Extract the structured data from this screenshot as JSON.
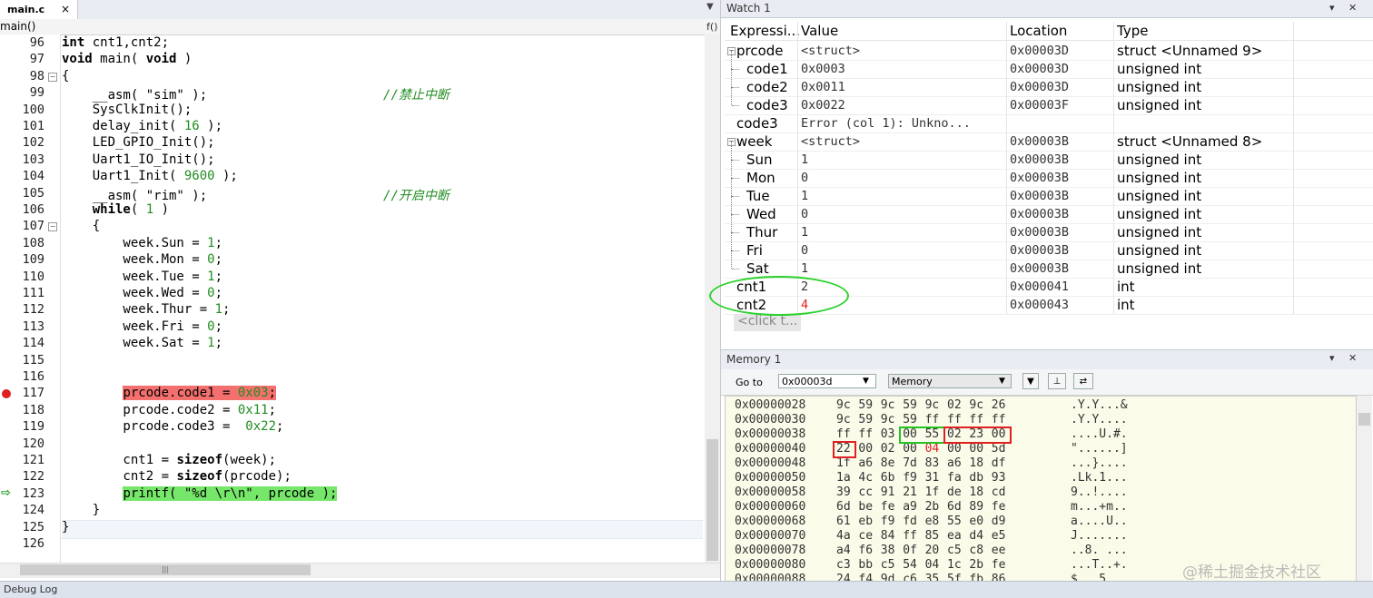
{
  "editor": {
    "tab_label": "main.c",
    "tab_close": "×",
    "tab_arrow": "▼",
    "function": "main()",
    "func_icon": "f()",
    "lines": [
      {
        "n": "96",
        "text": "int cnt1,cnt2;"
      },
      {
        "n": "97",
        "text": "void main( void )"
      },
      {
        "n": "98",
        "text": "{"
      },
      {
        "n": "99",
        "text": "    __asm( \"sim\" );                       //禁止中断"
      },
      {
        "n": "100",
        "text": "    SysClkInit();"
      },
      {
        "n": "101",
        "text": "    delay_init( 16 );"
      },
      {
        "n": "102",
        "text": "    LED_GPIO_Init();"
      },
      {
        "n": "103",
        "text": "    Uart1_IO_Init();"
      },
      {
        "n": "104",
        "text": "    Uart1_Init( 9600 );"
      },
      {
        "n": "105",
        "text": "    __asm( \"rim\" );                       //开启中断"
      },
      {
        "n": "106",
        "text": "    while( 1 )"
      },
      {
        "n": "107",
        "text": "    {"
      },
      {
        "n": "108",
        "text": "        week.Sun = 1;"
      },
      {
        "n": "109",
        "text": "        week.Mon = 0;"
      },
      {
        "n": "110",
        "text": "        week.Tue = 1;"
      },
      {
        "n": "111",
        "text": "        week.Wed = 0;"
      },
      {
        "n": "112",
        "text": "        week.Thur = 1;"
      },
      {
        "n": "113",
        "text": "        week.Fri = 0;"
      },
      {
        "n": "114",
        "text": "        week.Sat = 1;"
      },
      {
        "n": "115",
        "text": ""
      },
      {
        "n": "116",
        "text": ""
      },
      {
        "n": "117",
        "text": "        prcode.code1 = 0x03;"
      },
      {
        "n": "118",
        "text": "        prcode.code2 = 0x11;"
      },
      {
        "n": "119",
        "text": "        prcode.code3 =  0x22;"
      },
      {
        "n": "120",
        "text": ""
      },
      {
        "n": "121",
        "text": "        cnt1 = sizeof(week);"
      },
      {
        "n": "122",
        "text": "        cnt2 = sizeof(prcode);"
      },
      {
        "n": "123",
        "text": "        printf( \"%d \\r\\n\", prcode );"
      },
      {
        "n": "124",
        "text": "    }"
      },
      {
        "n": "125",
        "text": "}"
      },
      {
        "n": "126",
        "text": ""
      }
    ]
  },
  "watch": {
    "title": "Watch 1",
    "buttons": "▾ ✕",
    "headers": {
      "expr": "Expressi...",
      "value": "Value",
      "location": "Location",
      "type": "Type"
    },
    "rows": [
      {
        "name": "prcode",
        "value": "<struct>",
        "location": "0x00003D",
        "type": "struct <Unnamed 9>",
        "level": 0,
        "expand": true
      },
      {
        "name": "code1",
        "value": "0x0003",
        "location": "0x00003D",
        "type": "unsigned int",
        "level": 1
      },
      {
        "name": "code2",
        "value": "0x0011",
        "location": "0x00003D",
        "type": "unsigned int",
        "level": 1
      },
      {
        "name": "code3",
        "value": "0x0022",
        "location": "0x00003F",
        "type": "unsigned int",
        "level": 1
      },
      {
        "name": "code3",
        "value": "Error (col 1): Unkno...",
        "location": "",
        "type": "",
        "level": 0
      },
      {
        "name": "week",
        "value": "<struct>",
        "location": "0x00003B",
        "type": "struct <Unnamed 8>",
        "level": 0,
        "expand": true
      },
      {
        "name": "Sun",
        "value": "1",
        "location": "0x00003B",
        "type": "unsigned int",
        "level": 1
      },
      {
        "name": "Mon",
        "value": "0",
        "location": "0x00003B",
        "type": "unsigned int",
        "level": 1
      },
      {
        "name": "Tue",
        "value": "1",
        "location": "0x00003B",
        "type": "unsigned int",
        "level": 1
      },
      {
        "name": "Wed",
        "value": "0",
        "location": "0x00003B",
        "type": "unsigned int",
        "level": 1
      },
      {
        "name": "Thur",
        "value": "1",
        "location": "0x00003B",
        "type": "unsigned int",
        "level": 1
      },
      {
        "name": "Fri",
        "value": "0",
        "location": "0x00003B",
        "type": "unsigned int",
        "level": 1
      },
      {
        "name": "Sat",
        "value": "1",
        "location": "0x00003B",
        "type": "unsigned int",
        "level": 1
      },
      {
        "name": "cnt1",
        "value": "2",
        "location": "0x000041",
        "type": "int",
        "level": 0
      },
      {
        "name": "cnt2",
        "value": "4",
        "location": "0x000043",
        "type": "int",
        "level": 0,
        "changed": true
      }
    ],
    "click_to_add": "<click t..."
  },
  "memory": {
    "title": "Memory 1",
    "buttons": "▾ ✕",
    "goto_label": "Go to",
    "goto_value": "0x00003d",
    "zone": "Memory",
    "rows": [
      {
        "addr": "0x00000028",
        "bytes": [
          "9c",
          "59",
          "9c",
          "59",
          "9c",
          "02",
          "9c",
          "26"
        ],
        "ascii": ".Y.Y...&"
      },
      {
        "addr": "0x00000030",
        "bytes": [
          "9c",
          "59",
          "9c",
          "59",
          "ff",
          "ff",
          "ff",
          "ff"
        ],
        "ascii": ".Y.Y...."
      },
      {
        "addr": "0x00000038",
        "bytes": [
          "ff",
          "ff",
          "03",
          "00",
          "55",
          "02",
          "23",
          "00"
        ],
        "ascii": "....U.#."
      },
      {
        "addr": "0x00000040",
        "bytes": [
          "22",
          "00",
          "02",
          "00",
          "04",
          "00",
          "00",
          "5d"
        ],
        "ascii": "\"......]"
      },
      {
        "addr": "0x00000048",
        "bytes": [
          "1f",
          "a6",
          "8e",
          "7d",
          "83",
          "a6",
          "18",
          "df"
        ],
        "ascii": "...}...."
      },
      {
        "addr": "0x00000050",
        "bytes": [
          "1a",
          "4c",
          "6b",
          "f9",
          "31",
          "fa",
          "db",
          "93"
        ],
        "ascii": ".Lk.1..."
      },
      {
        "addr": "0x00000058",
        "bytes": [
          "39",
          "cc",
          "91",
          "21",
          "1f",
          "de",
          "18",
          "cd"
        ],
        "ascii": "9..!...."
      },
      {
        "addr": "0x00000060",
        "bytes": [
          "6d",
          "be",
          "fe",
          "a9",
          "2b",
          "6d",
          "89",
          "fe"
        ],
        "ascii": "m...+m.."
      },
      {
        "addr": "0x00000068",
        "bytes": [
          "61",
          "eb",
          "f9",
          "fd",
          "e8",
          "55",
          "e0",
          "d9"
        ],
        "ascii": "a....U.."
      },
      {
        "addr": "0x00000070",
        "bytes": [
          "4a",
          "ce",
          "84",
          "ff",
          "85",
          "ea",
          "d4",
          "e5"
        ],
        "ascii": "J......."
      },
      {
        "addr": "0x00000078",
        "bytes": [
          "a4",
          "f6",
          "38",
          "0f",
          "20",
          "c5",
          "c8",
          "ee"
        ],
        "ascii": "..8. ..."
      },
      {
        "addr": "0x00000080",
        "bytes": [
          "c3",
          "bb",
          "c5",
          "54",
          "04",
          "1c",
          "2b",
          "fe"
        ],
        "ascii": "...T..+."
      },
      {
        "addr": "0x00000088",
        "bytes": [
          "24",
          "f4",
          "9d",
          "c6",
          "35",
          "5f",
          "fb",
          "86"
        ],
        "ascii": "$...5_.."
      }
    ]
  },
  "bottom": {
    "debug_log": "Debug Log"
  },
  "watermark": "@稀土掘金技术社区"
}
